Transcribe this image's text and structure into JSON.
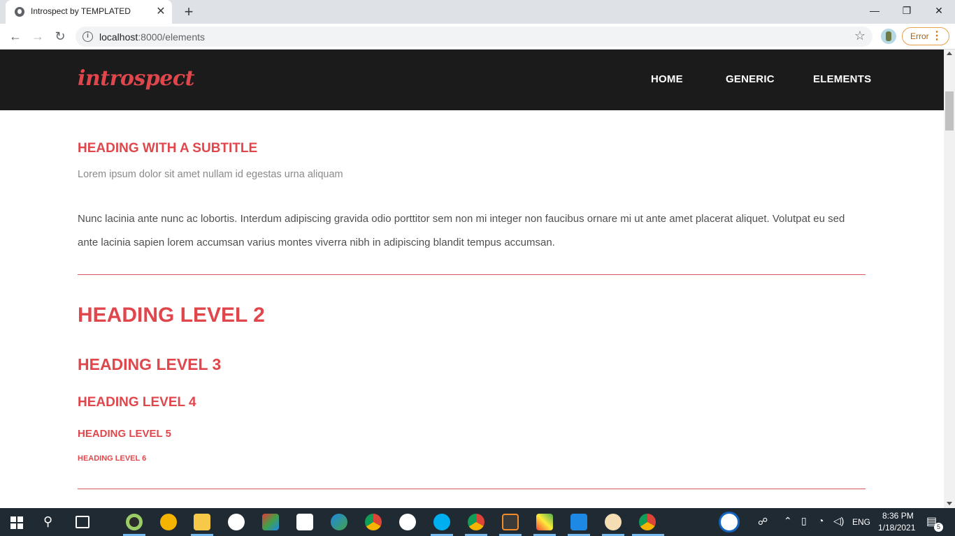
{
  "browser": {
    "tab_title": "Introspect by TEMPLATED",
    "tab_close": "✕",
    "new_tab": "+",
    "url_host": "localhost",
    "url_path": ":8000/elements",
    "error_label": "Error",
    "window_controls": [
      "—",
      "❐",
      "✕"
    ]
  },
  "site": {
    "logo": "introspect",
    "nav": [
      "HOME",
      "GENERIC",
      "ELEMENTS"
    ]
  },
  "content": {
    "heading_with_subtitle": "Heading with a Subtitle",
    "subtitle": "Lorem ipsum dolor sit amet nullam id egestas urna aliquam",
    "paragraph": "Nunc lacinia ante nunc ac lobortis. Interdum adipiscing gravida odio porttitor sem non mi integer non faucibus ornare mi ut ante amet placerat aliquet. Volutpat eu sed ante lacinia sapien lorem accumsan varius montes viverra nibh in adipiscing blandit tempus accumsan.",
    "h2": "Heading Level 2",
    "h3": "Heading Level 3",
    "h4": "Heading Level 4",
    "h5": "Heading Level 5",
    "h6": "Heading Level 6"
  },
  "taskbar": {
    "language": "ENG",
    "time": "8:36 PM",
    "date": "1/18/2021",
    "notifications": "5"
  },
  "colors": {
    "accent": "#e0474c",
    "header_bg": "#1b1b1b",
    "taskbar_bg": "#1f2a33"
  }
}
